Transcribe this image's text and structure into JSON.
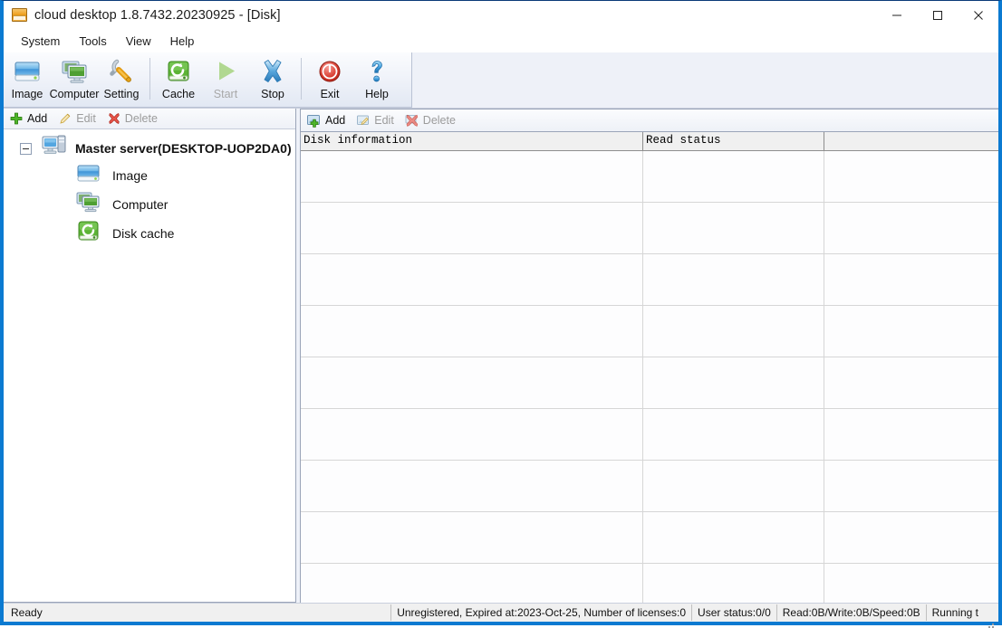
{
  "window": {
    "title": "cloud desktop 1.8.7432.20230925  - [Disk]",
    "icon": "disk-drive-icon",
    "controls": {
      "minimize": "minimize-icon",
      "maximize": "maximize-icon",
      "close": "close-icon"
    }
  },
  "menubar": {
    "items": [
      {
        "label": "System"
      },
      {
        "label": "Tools"
      },
      {
        "label": "View"
      },
      {
        "label": "Help"
      }
    ]
  },
  "toolbar": {
    "buttons": [
      {
        "label": "Image",
        "icon": "hard-disk-icon",
        "enabled": true
      },
      {
        "label": "Computer",
        "icon": "computers-icon",
        "enabled": true
      },
      {
        "label": "Setting",
        "icon": "wrench-icon",
        "enabled": true
      },
      {
        "label": "Cache",
        "icon": "refresh-disk-icon",
        "enabled": true
      },
      {
        "label": "Start",
        "icon": "play-icon",
        "enabled": false
      },
      {
        "label": "Stop",
        "icon": "cross-x-icon",
        "enabled": true
      },
      {
        "label": "Exit",
        "icon": "power-icon",
        "enabled": true
      },
      {
        "label": "Help",
        "icon": "question-mark-icon",
        "enabled": true
      }
    ]
  },
  "left_pane": {
    "toolbar": [
      {
        "label": "Add",
        "icon": "green-plus-icon",
        "enabled": true
      },
      {
        "label": "Edit",
        "icon": "pencil-icon",
        "enabled": false
      },
      {
        "label": "Delete",
        "icon": "red-x-icon",
        "enabled": false
      }
    ],
    "tree": {
      "root": {
        "label": "Master server(DESKTOP-UOP2DA0)",
        "icon": "server-computer-icon",
        "expanded": true
      },
      "children": [
        {
          "label": "Image",
          "icon": "hard-disk-icon"
        },
        {
          "label": "Computer",
          "icon": "computers-icon"
        },
        {
          "label": "Disk cache",
          "icon": "refresh-disk-icon"
        }
      ]
    }
  },
  "right_pane": {
    "toolbar": [
      {
        "label": "Add",
        "icon": "add-image-icon",
        "enabled": true
      },
      {
        "label": "Edit",
        "icon": "edit-image-icon",
        "enabled": false
      },
      {
        "label": "Delete",
        "icon": "delete-x-icon",
        "enabled": false
      }
    ],
    "grid": {
      "columns": [
        {
          "label": "Disk information"
        },
        {
          "label": "Read status"
        },
        {
          "label": ""
        }
      ],
      "rows": [],
      "empty_row_count": 9
    }
  },
  "statusbar": {
    "message": "Ready",
    "segments": [
      {
        "text": "Unregistered, Expired at:2023-Oct-25, Number of licenses:0"
      },
      {
        "text": "User status:0/0"
      },
      {
        "text": "Read:0B/Write:0B/Speed:0B"
      },
      {
        "text": "Running t"
      }
    ]
  },
  "colors": {
    "window_border": "#0b7ad1",
    "toolbar_bg": "#eff2f9",
    "accent_green": "#4caf27",
    "accent_blue": "#2e8fd6",
    "accent_red": "#d63a2f",
    "grid_line": "#d6d6d6"
  }
}
